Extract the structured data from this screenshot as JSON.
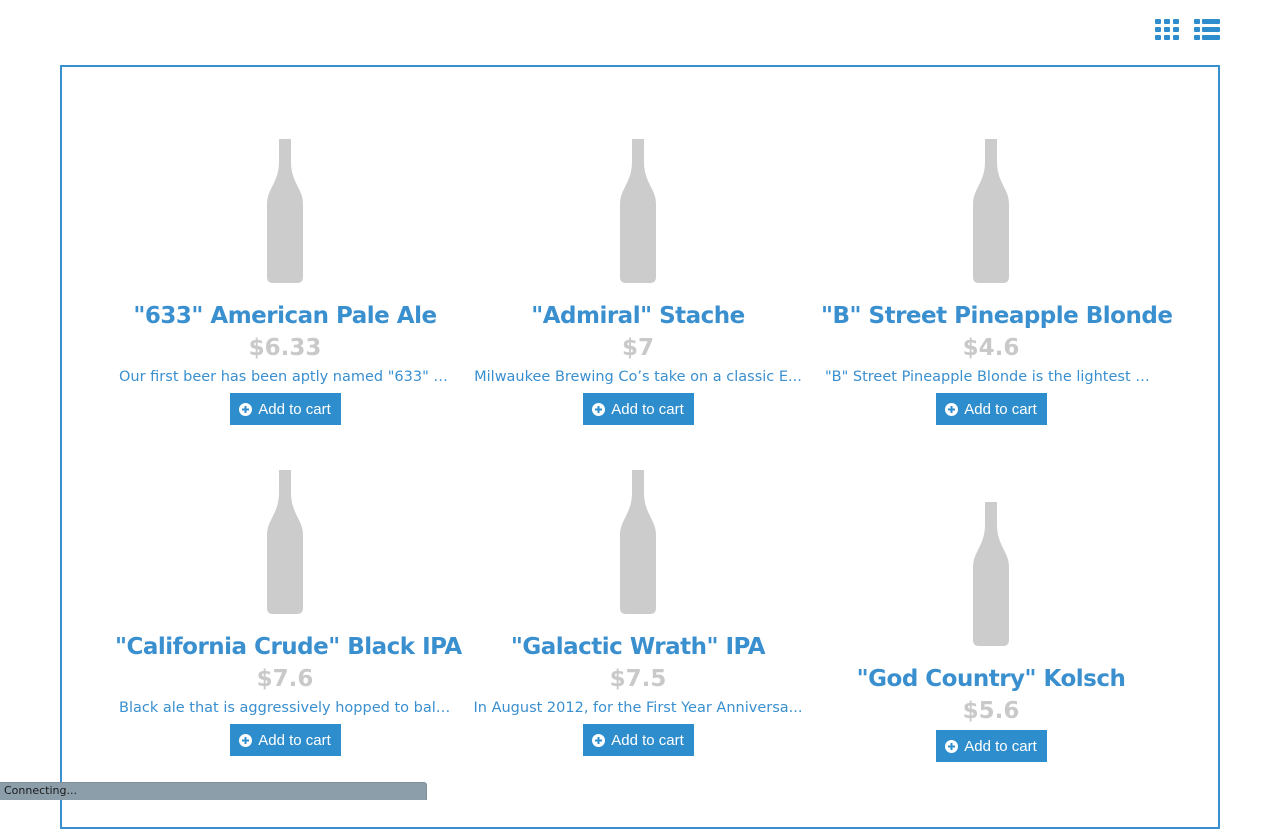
{
  "view_toggles": {
    "grid_icon": "grid-view-icon",
    "list_icon": "list-view-icon"
  },
  "colors": {
    "accent": "#3a8fcf",
    "button": "#2e8dcd",
    "price": "#c9c9c9",
    "bottle": "#cccccc"
  },
  "products": [
    {
      "name": "\"633\" American Pale Ale",
      "price": "$6.33",
      "description": "Our first beer has been aptly named \"633\" a...",
      "button_label": "Add to cart"
    },
    {
      "name": "\"Admiral\" Stache",
      "price": "$7",
      "description": "Milwaukee Brewing Co’s take on a classic E...",
      "button_label": "Add to cart"
    },
    {
      "name": "\"B\" Street Pineapple Blonde",
      "price": "$4.6",
      "description": "\"B\" Street Pineapple Blonde is the lightest b...",
      "button_label": "Add to cart"
    },
    {
      "name": "\"California Crude\" Black IPA",
      "price": "$7.6",
      "description": "Black ale that is aggressively hopped to bala...",
      "button_label": "Add to cart"
    },
    {
      "name": "\"Galactic Wrath\" IPA",
      "price": "$7.5",
      "description": "In August 2012, for the First Year Anniversa...",
      "button_label": "Add to cart"
    },
    {
      "name": "\"God Country\" Kolsch",
      "price": "$5.6",
      "description": "",
      "button_label": "Add to cart"
    }
  ],
  "status_bar": {
    "text": "Connecting..."
  }
}
